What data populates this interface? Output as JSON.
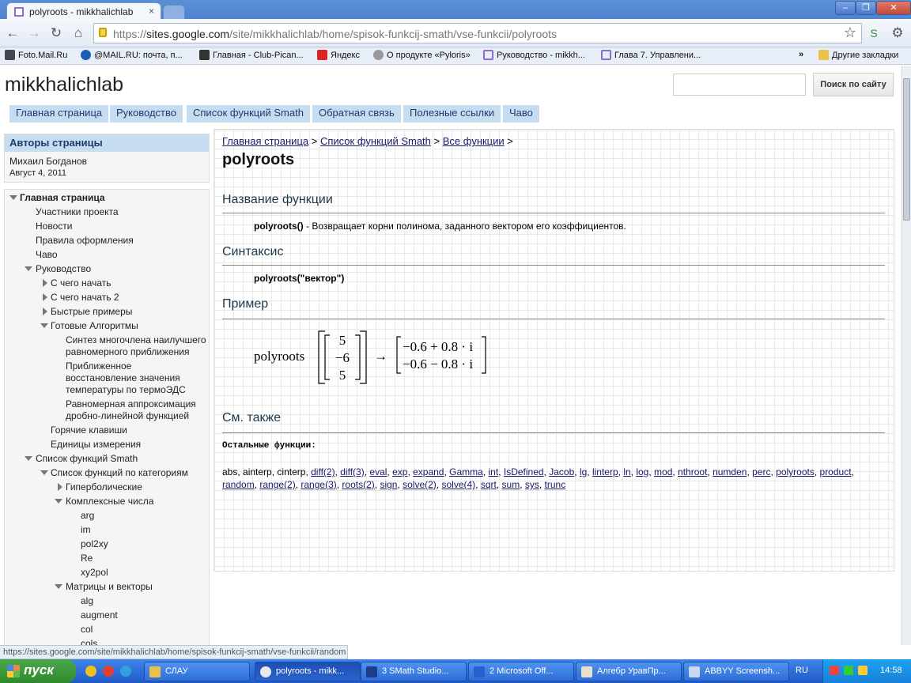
{
  "browser": {
    "tab_title": "polyroots - mikkhalichlab",
    "tab_close": "×",
    "url_scheme": "https://",
    "url_host": "sites.google.com",
    "url_path": "/site/mikkhalichlab/home/spisok-funkcij-smath/vse-funkcii/polyroots",
    "win_min": "‒",
    "win_max": "❐",
    "win_close": "✕",
    "bookmarks": [
      {
        "label": "Foto.Mail.Ru",
        "color": "#445"
      },
      {
        "label": "@MAIL.RU: почта, п...",
        "color": "#1a5fb4"
      },
      {
        "label": "Главная - Club-Pican...",
        "color": "#333"
      },
      {
        "label": "Яндекс",
        "color": "#d22"
      },
      {
        "label": "О продукте «Pyloris»",
        "color": "#999"
      },
      {
        "label": "Руководство - mikkh...",
        "color": "#8a6ed0"
      },
      {
        "label": "Глава 7. Управлени...",
        "color": "#8a6ed0"
      }
    ],
    "bookmarks_more": "»",
    "other_bookmarks": "Другие закладки"
  },
  "site": {
    "title": "mikkhalichlab",
    "search_button": "Поиск по сайту",
    "search_value": "",
    "nav": [
      "Главная страница",
      "Руководство",
      "Список функций Smath",
      "Обратная связь",
      "Полезные ссылки",
      "Чаво"
    ]
  },
  "sidebar": {
    "authors_heading": "Авторы страницы",
    "author_name": "Михаил Богданов",
    "author_date": "Август 4, 2011",
    "tree": [
      {
        "label": "Главная страница",
        "bold": true
      },
      {
        "label": "Участники проекта"
      },
      {
        "label": "Новости"
      },
      {
        "label": "Правила оформления"
      },
      {
        "label": "Чаво"
      },
      {
        "label": "Руководство"
      },
      {
        "label": "С чего начать"
      },
      {
        "label": "С чего начать 2"
      },
      {
        "label": "Быстрые примеры"
      },
      {
        "label": "Готовые Алгоритмы"
      },
      {
        "label": "Синтез многочлена наилучшего равномерного приближения"
      },
      {
        "label": "Приближенное восстановление значения температуры по термоЭДС"
      },
      {
        "label": "Равномерная аппроксимация дробно-линейной функцией"
      },
      {
        "label": "Горячие клавиши"
      },
      {
        "label": "Единицы измерения"
      },
      {
        "label": "Список функций Smath"
      },
      {
        "label": "Список функций по категориям"
      },
      {
        "label": "Гиперболические"
      },
      {
        "label": "Комплексные числа"
      },
      {
        "label": "arg"
      },
      {
        "label": "im"
      },
      {
        "label": "pol2xy"
      },
      {
        "label": "Re"
      },
      {
        "label": "xy2pol"
      },
      {
        "label": "Матрицы и векторы"
      },
      {
        "label": "alg"
      },
      {
        "label": "augment"
      },
      {
        "label": "col"
      },
      {
        "label": "cols"
      }
    ]
  },
  "content": {
    "breadcrumb": [
      "Главная страница",
      "Список функций Smath",
      "Все функции"
    ],
    "breadcrumb_sep": ">",
    "page_title": "polyroots",
    "h_name": "Название функции",
    "func_sig": "polyroots()",
    "func_desc": " - Возвращает корни полинома, заданного вектором его коэффициентов.",
    "h_syntax": "Синтаксис",
    "syntax": "polyroots(\"вектор\")",
    "h_example": "Пример",
    "example": {
      "fn": "polyroots",
      "vector": [
        "5",
        "−6",
        "5"
      ],
      "arrow": "→",
      "results": [
        "−0.6 + 0.8 · i",
        "−0.6 − 0.8 · i"
      ]
    },
    "h_see_also": "См. также",
    "other_functions_label": "Остальные функции:",
    "plain_functions": [
      "abs",
      "ainterp",
      "cinterp"
    ],
    "linked_functions": [
      "diff(2)",
      "diff(3)",
      "eval",
      "exp",
      "expand",
      "Gamma",
      "int",
      "IsDefined",
      "Jacob",
      "lg",
      "linterp",
      "ln",
      "log",
      "mod",
      "nthroot",
      "numden",
      "perc",
      "polyroots",
      "product",
      "random",
      "range(2)",
      "range(3)",
      "roots(2)",
      "sign",
      "solve(2)",
      "solve(4)",
      "sqrt",
      "sum",
      "sys",
      "trunc"
    ]
  },
  "status": "https://sites.google.com/site/mikkhalichlab/home/spisok-funkcij-smath/vse-funkcii/random",
  "taskbar": {
    "start": "пуск",
    "items": [
      {
        "label": "СЛАУ",
        "color": "#e8c24a"
      },
      {
        "label": "polyroots - mikk...",
        "color": "#e8e8e8"
      },
      {
        "label": "3 SMath Studio...",
        "color": "#1c3e8a"
      },
      {
        "label": "2 Microsoft Off...",
        "color": "#2a5fd0"
      },
      {
        "label": "Алгебр УравПр...",
        "color": "#e8e0c8"
      },
      {
        "label": "ABBYY Screensh...",
        "color": "#c8d8f0"
      }
    ],
    "lang": "RU",
    "clock": "14:58"
  }
}
